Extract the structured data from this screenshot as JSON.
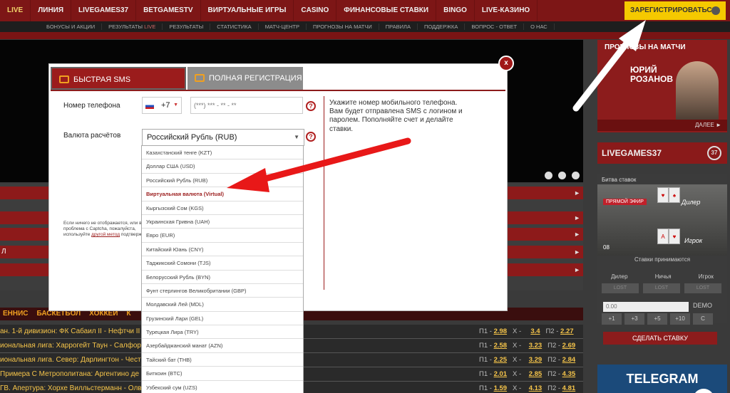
{
  "top_nav": [
    "LIVE",
    "ЛИНИЯ",
    "LIVEGAMES37",
    "BETGAMESTV",
    "ВИРТУАЛЬНЫЕ ИГРЫ",
    "CASINO",
    "ФИНАНСОВЫЕ СТАВКИ",
    "BINGO",
    "LIVE-КАЗИНО"
  ],
  "register_button": "ЗАРЕГИСТРИРОВАТЬСЯ",
  "sub_nav": [
    "БОНУСЫ И АКЦИИ",
    "РЕЗУЛЬТАТЫ",
    "РЕЗУЛЬТАТЫ",
    "СТАТИСТИКА",
    "МАТЧ-ЦЕНТР",
    "ПРОГНОЗЫ НА МАТЧИ",
    "ПРАВИЛА",
    "ПОДДЕРЖКА",
    "ВОПРОС - ОТВЕТ",
    "О НАС"
  ],
  "sub_nav_live": "LIVE",
  "modal": {
    "close": "x",
    "tab_sms": "БЫСТРАЯ SMS РЕГИСТРАЦИЯ",
    "tab_full": "ПОЛНАЯ РЕГИСТРАЦИЯ",
    "phone_label": "Номер телефона",
    "phone_code": "+7",
    "phone_placeholder": "(***) *** - ** - **",
    "currency_label": "Валюта расчётов",
    "currency_selected": "Российский Рубль (RUB)",
    "help": "?",
    "info": "Укажите номер мобильного телефона. Вам будет отправлена SMS с логином и паролем. Пополняйте счет и делайте ставки.",
    "captcha_text": "Если ничего не отображается, или возникла проблема с Captcha, пожалуйста, используйте",
    "captcha_link": "другой метод",
    "captcha_tail": "подтверждения"
  },
  "currency_options": [
    "Казахстанский тенге (KZT)",
    "Доллар США (USD)",
    "Российский Рубль (RUB)",
    "Виртуальная валюта (Virtual)",
    "Кыргызский Сом (KGS)",
    "Украинская Гривна (UAH)",
    "Евро (EUR)",
    "Китайский Юань (CNY)",
    "Таджикский Сомони (TJS)",
    "Белорусский Рубль (BYN)",
    "Фунт стерлингов Великобритании (GBP)",
    "Молдавский Лей (MDL)",
    "Грузинский Лари (GEL)",
    "Турецкая Лира (TRY)",
    "Азербайджанский манат (AZN)",
    "Тайский бат (THB)",
    "Биткоин (BTC)",
    "Узбекский сум (UZS)"
  ],
  "selected_index": 3,
  "left_bar": "Л",
  "sport_tabs": [
    "ЕННИС",
    "БАСКЕТБОЛ",
    "ХОККЕЙ",
    "К"
  ],
  "matches": [
    {
      "name": "ан. 1-й дивизион: ФК Сабаил II - Нефтчи II",
      "p1": "2.98",
      "x": "3.4",
      "p2": "2.27"
    },
    {
      "name": "иональная лига: Харрогейт Таун - Салфор",
      "p1": "2.58",
      "x": "3.23",
      "p2": "2.69"
    },
    {
      "name": "иональная лига. Север: Дарлингтон - Чест",
      "p1": "2.25",
      "x": "3.29",
      "p2": "2.84"
    },
    {
      "name": "Примера С Метрополитана: Аргентино де К",
      "p1": "2.01",
      "x": "2.85",
      "p2": "4.35"
    },
    {
      "name": "ГВ. Апертура: Хорхе Вилльстерманн - Олв",
      "p1": "1.59",
      "x": "4.13",
      "p2": "4.81"
    }
  ],
  "odds_labels": {
    "p1": "П1 -",
    "x": "X -",
    "p2": "П2 -"
  },
  "sidebar": {
    "predictions_title": "ПРОГНОЗЫ НА МАТЧИ",
    "expert_name_1": "ЮРИЙ",
    "expert_name_2": "РОЗАНОВ",
    "more": "ДАЛЕЕ ►",
    "livegames_banner": "LIVEGAMES37",
    "livegames_badge": "37",
    "battle_title": "Битва ставок",
    "live_badge": "ПРЯМОЙ ЭФИР",
    "dealer": "Дилер",
    "player": "Игрок",
    "counter": "08",
    "accepting": "Ставки принимаются",
    "cols": [
      "Дилер",
      "Ничья",
      "Игрок"
    ],
    "lost": "LOST",
    "amount": "0.00",
    "demo": "DEMO",
    "steps": [
      "+1",
      "+3",
      "+5",
      "+10",
      "C"
    ],
    "make_bet": "СДЕЛАТЬ СТАВКУ",
    "telegram": "TELEGRAM"
  }
}
